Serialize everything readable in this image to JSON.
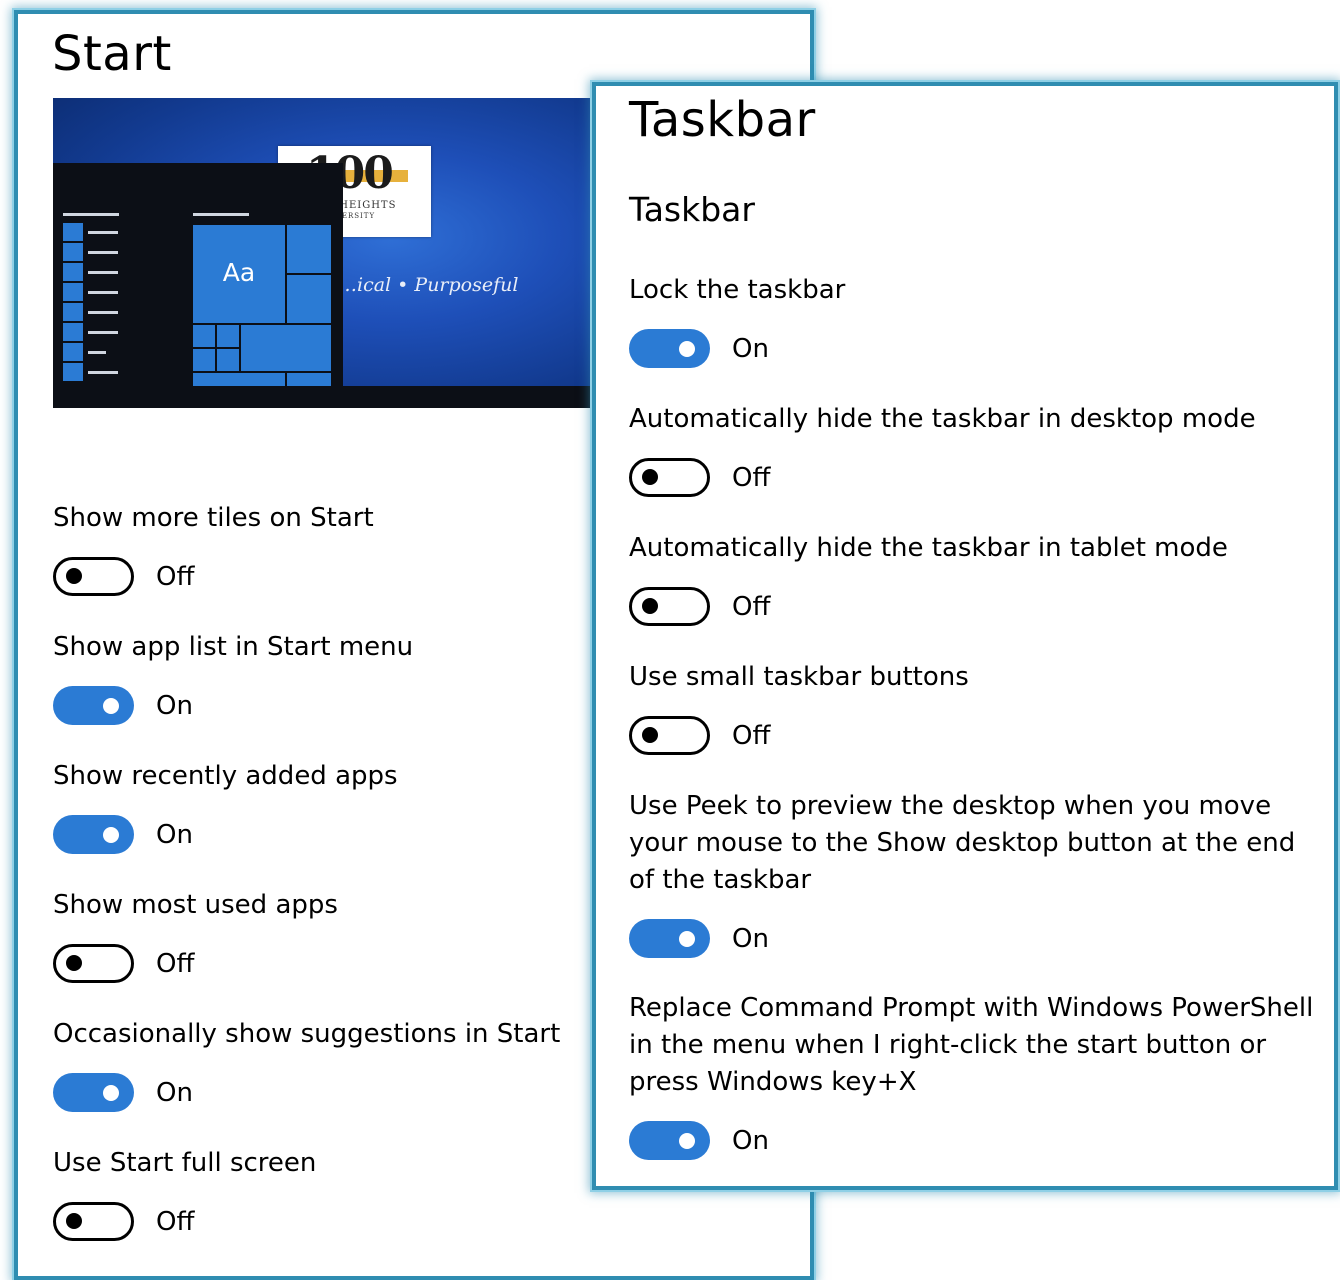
{
  "start": {
    "title": "Start",
    "preview": {
      "tile_label": "Aa",
      "logo_number": "100",
      "logo_text": "SIENA HEIGHTS",
      "logo_subtext": "UNIVERSITY",
      "script_text": "…ical • Purposeful"
    },
    "settings": [
      {
        "label": "Show more tiles on Start",
        "state": "Off"
      },
      {
        "label": "Show app list in Start menu",
        "state": "On"
      },
      {
        "label": "Show recently added apps",
        "state": "On"
      },
      {
        "label": "Show most used apps",
        "state": "Off"
      },
      {
        "label": "Occasionally show suggestions in Start",
        "state": "On"
      },
      {
        "label": "Use Start full screen",
        "state": "Off"
      }
    ]
  },
  "taskbar": {
    "title": "Taskbar",
    "section_title": "Taskbar",
    "settings": [
      {
        "label": "Lock the taskbar",
        "state": "On"
      },
      {
        "label": "Automatically hide the taskbar in desktop mode",
        "state": "Off"
      },
      {
        "label": "Automatically hide the taskbar in tablet mode",
        "state": "Off"
      },
      {
        "label": "Use small taskbar buttons",
        "state": "Off"
      },
      {
        "label": "Use Peek to preview the desktop when you move your mouse to the Show desktop button at the end of the taskbar",
        "state": "On"
      },
      {
        "label": "Replace Command Prompt with Windows PowerShell in the menu when I right-click the start button or press Windows key+X",
        "state": "On"
      }
    ]
  },
  "colors": {
    "accent": "#2b7bd4",
    "panel_border": "#2f8db1"
  }
}
